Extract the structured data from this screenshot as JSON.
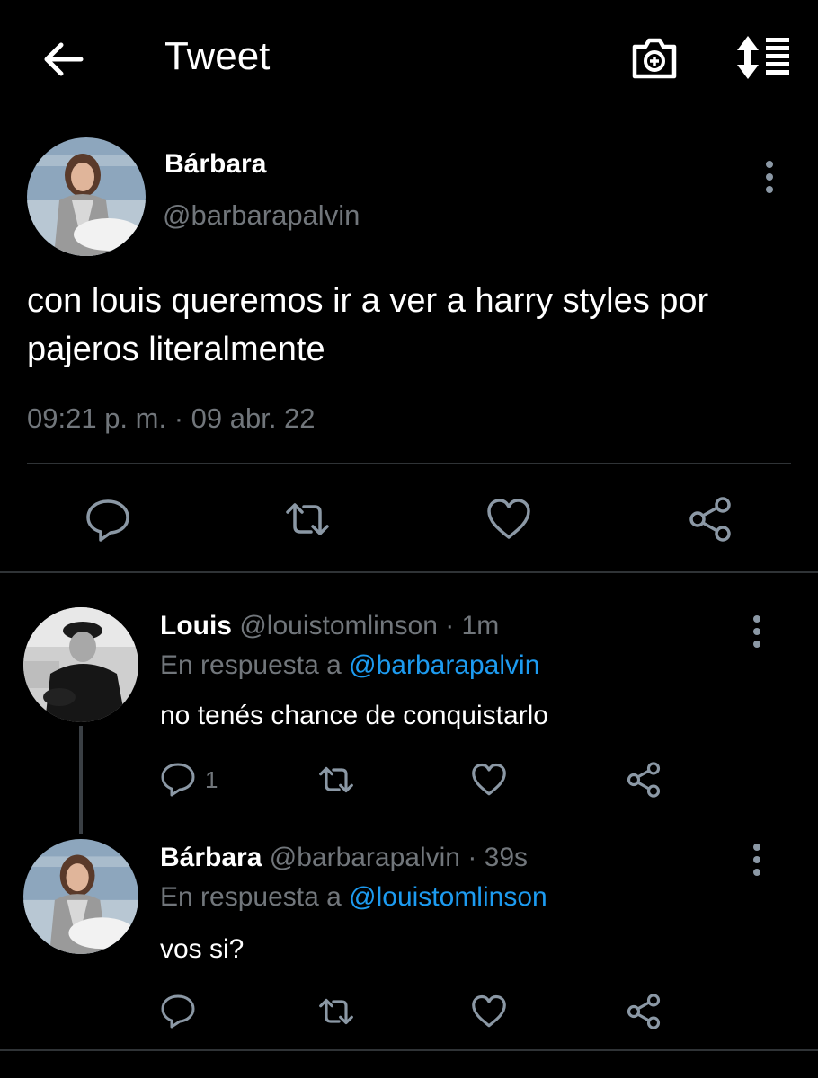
{
  "header": {
    "title": "Tweet",
    "back_icon": "arrow-left-icon",
    "camera_icon": "camera-plus-icon",
    "sort_icon": "sort-icon"
  },
  "main_tweet": {
    "name": "Bárbara",
    "handle": "@barbarapalvin",
    "text": "con louis queremos ir a ver a harry styles por pajeros literalmente",
    "time": "09:21 p. m. · 09 abr. 22",
    "actions": [
      "reply-icon",
      "retweet-icon",
      "like-icon",
      "share-icon"
    ]
  },
  "replies": [
    {
      "name": "Louis",
      "handle": "@louistomlinson",
      "time": "· 1m",
      "reply_prefix": "En respuesta a",
      "reply_to": "@barbarapalvin",
      "text": "no tenés chance de conquistarlo",
      "reply_count": "1"
    },
    {
      "name": "Bárbara",
      "handle": "@barbarapalvin",
      "time": "· 39s",
      "reply_prefix": "En respuesta a",
      "reply_to": "@louistomlinson",
      "text": "vos si?",
      "reply_count": ""
    }
  ],
  "colors": {
    "background": "#000000",
    "text": "#ffffff",
    "muted": "#71767b",
    "accent": "#1d9bf0",
    "icon": "#8b98a5"
  }
}
